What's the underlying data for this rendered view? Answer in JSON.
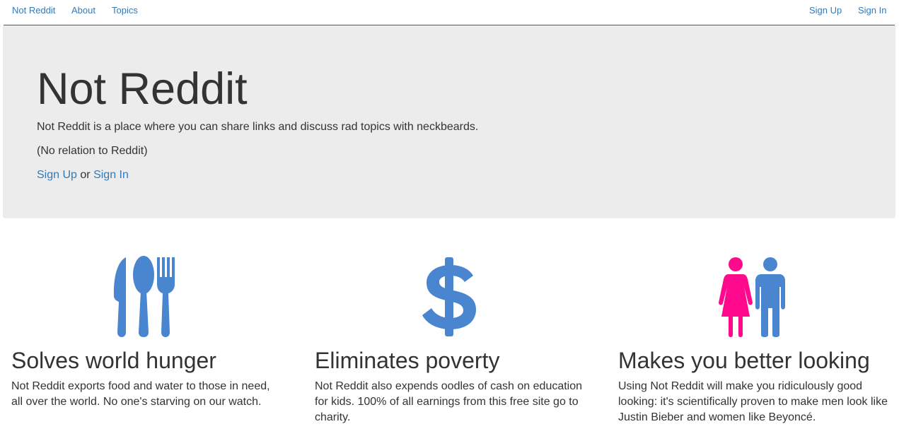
{
  "navbar": {
    "brand": "Not Reddit",
    "links": [
      "About",
      "Topics"
    ],
    "right_links": [
      "Sign Up",
      "Sign In"
    ]
  },
  "hero": {
    "title": "Not Reddit",
    "tagline": "Not Reddit is a place where you can share links and discuss rad topics with neckbeards.",
    "disclaimer": "(No relation to Reddit)",
    "signup_label": "Sign Up",
    "or_text": "or",
    "signin_label": "Sign In"
  },
  "features": [
    {
      "icon": "cutlery-icon",
      "heading": "Solves world hunger",
      "body": "Not Reddit exports food and water to those in need, all over the world. No one's starving on our watch."
    },
    {
      "icon": "dollar-icon",
      "heading": "Eliminates poverty",
      "body": "Not Reddit also expends oodles of cash on education for kids. 100% of all earnings from this free site go to charity."
    },
    {
      "icon": "woman-man-icon",
      "heading": "Makes you better looking",
      "body": "Using Not Reddit will make you ridiculously good looking: it's scientifically proven to make men look like Justin Bieber and women like Beyoncé."
    }
  ],
  "colors": {
    "link": "#337ab7",
    "icon_blue": "#4a86cf",
    "icon_pink": "#ff0a8c",
    "jumbotron_bg": "#ececec"
  }
}
